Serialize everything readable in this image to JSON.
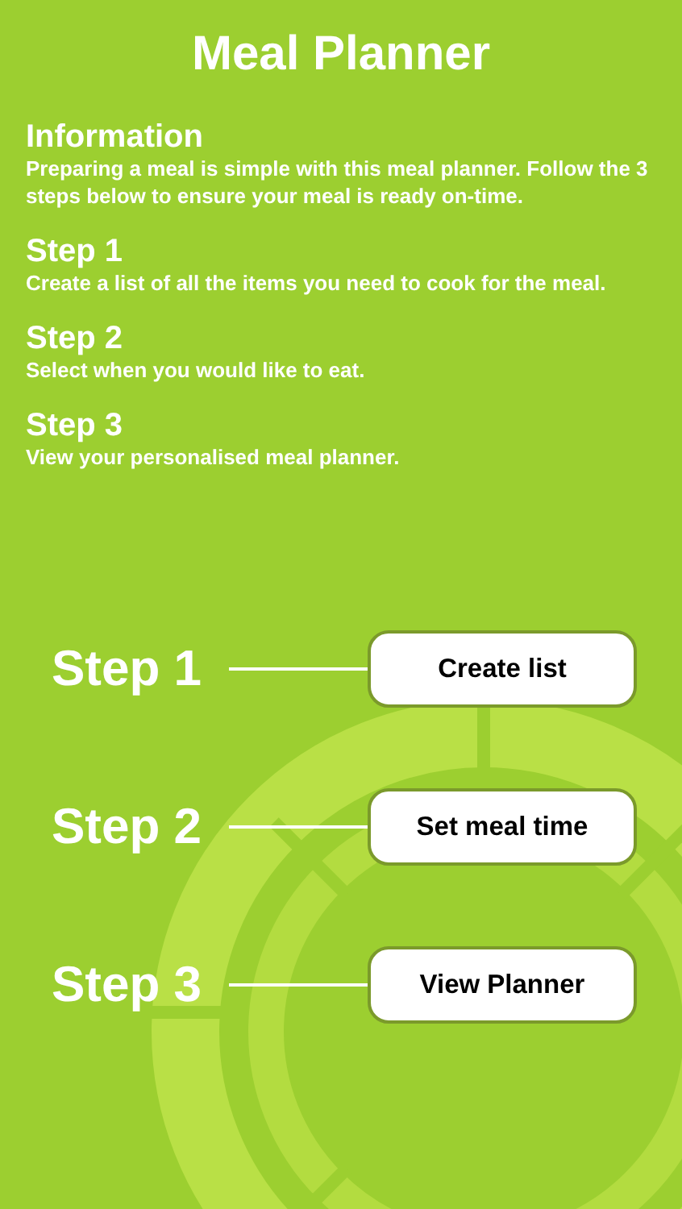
{
  "title": "Meal Planner",
  "sections": [
    {
      "heading": "Information",
      "text": "Preparing a meal is simple with this meal planner. Follow the 3 steps below to ensure your meal is ready on-time."
    },
    {
      "heading": "Step 1",
      "text": "Create a list of all the items you need to cook for the meal."
    },
    {
      "heading": "Step 2",
      "text": "Select when you would like to eat."
    },
    {
      "heading": "Step 3",
      "text": "View your personalised meal planner."
    }
  ],
  "steps": [
    {
      "label": "Step 1",
      "button": "Create list"
    },
    {
      "label": "Step 2",
      "button": "Set meal time"
    },
    {
      "label": "Step 3",
      "button": "View Planner"
    }
  ]
}
